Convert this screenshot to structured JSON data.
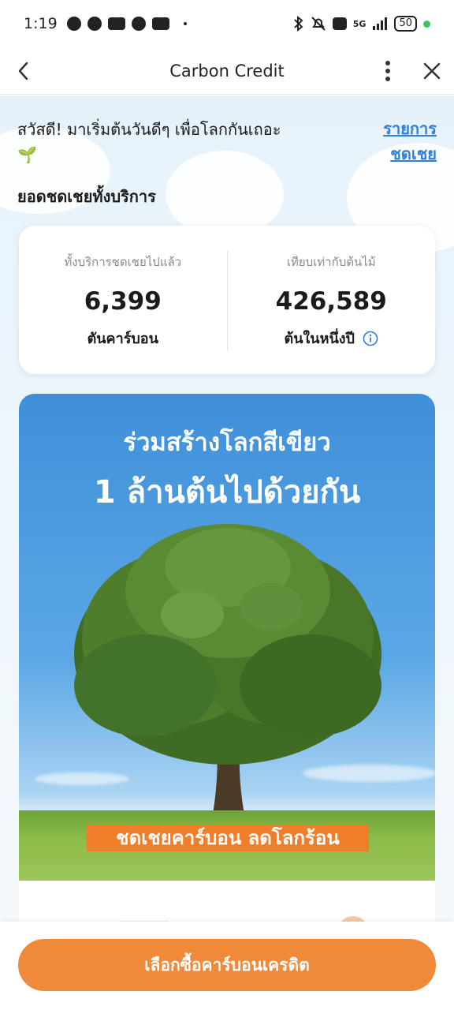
{
  "status_bar": {
    "time": "1:19",
    "battery": "50",
    "network": "5G"
  },
  "header": {
    "title": "Carbon Credit"
  },
  "greeting": {
    "text": "สวัสดี! มาเริ่มต้นวันดีๆ เพื่อโลกกันเถอะ",
    "emoji": "🌱"
  },
  "history_link": {
    "line1": "รายการ",
    "line2": "ชดเชย"
  },
  "section_title": "ยอดชดเชยทั้งบริการ",
  "stats": {
    "left": {
      "label": "ทั้งบริการชดเชยไปแล้ว",
      "value": "6,399",
      "unit": "ตันคาร์บอน"
    },
    "right": {
      "label": "เทียบเท่ากับต้นไม้",
      "value": "426,589",
      "unit": "ต้นในหนึ่งปี"
    }
  },
  "banner": {
    "title_line1": "ร่วมสร้างโลกสีเขียว",
    "title_line2": "1 ล้านต้นไปด้วยกัน",
    "tag": "ชดเชยคาร์บอน ลดโลกร้อน"
  },
  "cta": {
    "label": "เลือกซื้อคาร์บอนเครดิต"
  },
  "colors": {
    "accent": "#ef8a3a",
    "link": "#2f7fd8",
    "tag": "#ef7d2a"
  }
}
